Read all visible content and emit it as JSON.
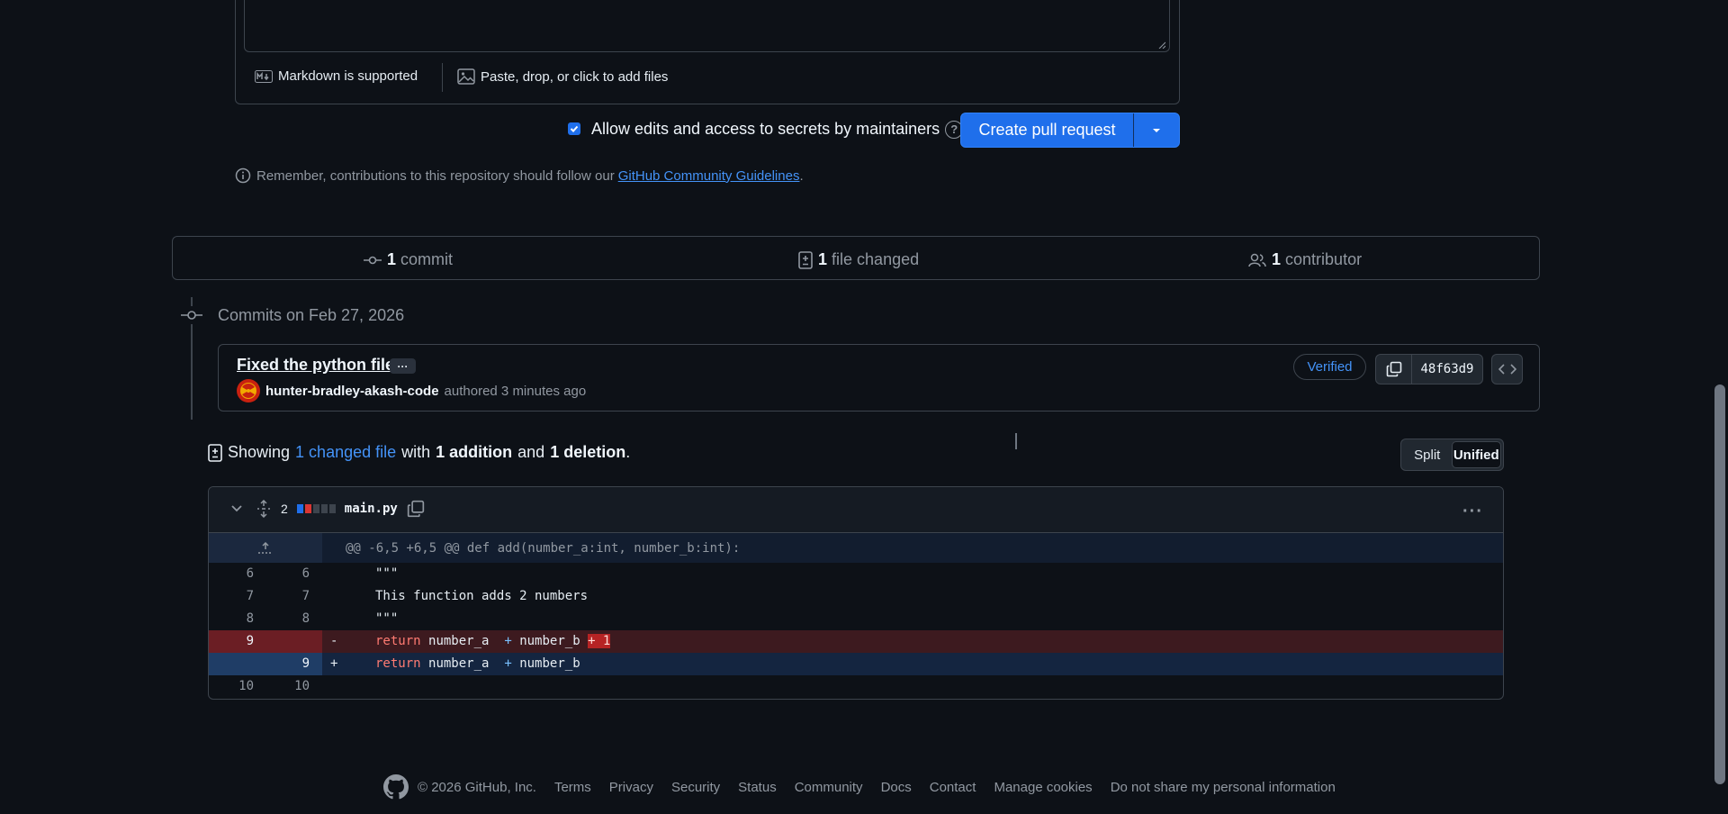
{
  "composer": {
    "markdown_label": "Markdown is supported",
    "attach_label": "Paste, drop, or click to add files"
  },
  "actions": {
    "allow_edits_label": "Allow edits and access to secrets by maintainers",
    "allow_edits_checked": true,
    "help_glyph": "?",
    "create_pr_label": "Create pull request"
  },
  "notice": {
    "prefix": "Remember, contributions to this repository should follow our",
    "link": "GitHub Community Guidelines",
    "suffix": "."
  },
  "summary": {
    "commits_count": "1",
    "commits_label": "commit",
    "files_count": "1",
    "files_label": "file changed",
    "contributors_count": "1",
    "contributors_label": "contributor"
  },
  "timeline": {
    "date_label": "Commits on Feb 27, 2026",
    "commit": {
      "title": "Fixed the python file",
      "more_glyph": "···",
      "author": "hunter-bradley-akash-code",
      "authored_text": "authored 3 minutes ago",
      "verified_label": "Verified",
      "sha": "48f63d9"
    }
  },
  "showing": {
    "prefix": "Showing",
    "files_link": "1 changed file",
    "with": "with",
    "additions": "1 addition",
    "and": "and",
    "deletions": "1 deletion",
    "suffix": "."
  },
  "view_toggle": {
    "split_label": "Split",
    "unified_label": "Unified",
    "active": "Unified"
  },
  "diff": {
    "change_count": "2",
    "filename": "main.py",
    "more_glyph": "···",
    "hunk_header": "@@ -6,5 +6,5 @@ def add(number_a:int, number_b:int):",
    "lines": [
      {
        "old": "6",
        "new": "6",
        "mark": "",
        "type": "context",
        "code": "\"\"\""
      },
      {
        "old": "7",
        "new": "7",
        "mark": "",
        "type": "context",
        "code": "This function adds 2 numbers"
      },
      {
        "old": "8",
        "new": "8",
        "mark": "",
        "type": "context",
        "code": "\"\"\""
      },
      {
        "old": "9",
        "new": "",
        "mark": "-",
        "type": "deletion",
        "code_kw": "return",
        "code_a": "number_a",
        "code_op": "+",
        "code_b": "number_b",
        "code_removed": "+ 1"
      },
      {
        "old": "",
        "new": "9",
        "mark": "+",
        "type": "addition",
        "code_kw": "return",
        "code_a": "number_a",
        "code_op": "+",
        "code_b": "number_b"
      },
      {
        "old": "10",
        "new": "10",
        "mark": "",
        "type": "context",
        "code": ""
      }
    ]
  },
  "footer": {
    "copyright": "© 2026 GitHub, Inc.",
    "links": [
      "Terms",
      "Privacy",
      "Security",
      "Status",
      "Community",
      "Docs",
      "Contact",
      "Manage cookies",
      "Do not share my personal information"
    ]
  },
  "colors": {
    "background": "#0d1117",
    "primary_button": "#1f6feb",
    "link": "#4493f8",
    "deletion": "#da3633",
    "addition_block": "#1f6feb"
  }
}
